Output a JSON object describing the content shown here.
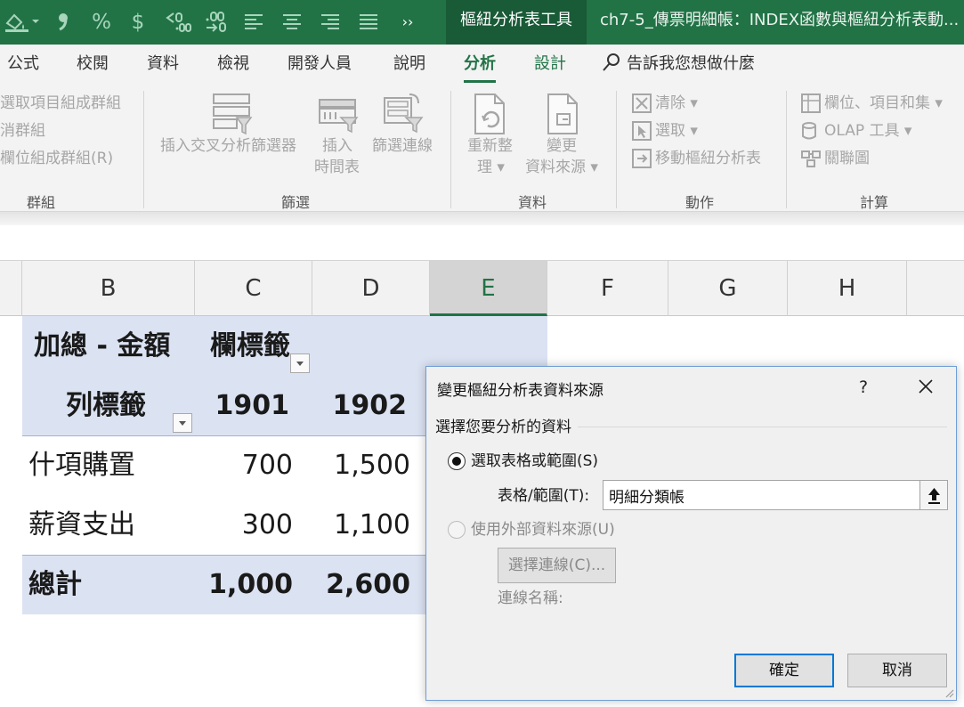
{
  "quick_access": {
    "icons": [
      "fill-color-icon",
      "comma-icon",
      "percent-icon",
      "currency-icon",
      "increase-decimal-icon",
      "decrease-decimal-icon",
      "align-left-icon",
      "align-center-icon",
      "align-right-icon",
      "justify-icon",
      "more-icon"
    ],
    "percent_glyph": "%",
    "currency_glyph": "$",
    "more_glyph": "››"
  },
  "titlebar": {
    "context_tab": "樞紐分析表工具",
    "document_title": "ch7-5_傳票明細帳：INDEX函數與樞紐分析表動..."
  },
  "tabs": [
    {
      "label": "公式"
    },
    {
      "label": "校閱"
    },
    {
      "label": "資料"
    },
    {
      "label": "檢視"
    },
    {
      "label": "開發人員"
    },
    {
      "label": "說明"
    },
    {
      "label": "分析",
      "active": true
    },
    {
      "label": "設計"
    }
  ],
  "tell_me": "告訴我您想做什麼",
  "ribbon": {
    "group_group": {
      "items": [
        "選取項目組成群組",
        "消群組",
        "欄位組成群組(R)"
      ],
      "name": "群組"
    },
    "group_filter": {
      "slicer": "插入交叉分析篩選器",
      "timeline_line1": "插入",
      "timeline_line2": "時間表",
      "connections": "篩選連線",
      "name": "篩選"
    },
    "group_data": {
      "refresh_line1": "重新整",
      "refresh_line2": "理 ▾",
      "change_line1": "變更",
      "change_line2": "資料來源 ▾",
      "name": "資料"
    },
    "group_actions": {
      "clear": "清除 ▾",
      "select": "選取 ▾",
      "move": "移動樞紐分析表",
      "name": "動作"
    },
    "group_calc": {
      "fields": "欄位、項目和集 ▾",
      "olap": "OLAP 工具 ▾",
      "relations": "關聯圖",
      "name": "計算"
    }
  },
  "columns": [
    "B",
    "C",
    "D",
    "E",
    "F",
    "G",
    "H"
  ],
  "selected_column": "E",
  "pivot": {
    "values_label": "加總 - 金額",
    "col_labels": "欄標籤",
    "row_labels": "列標籤",
    "headers": [
      "1901",
      "1902"
    ],
    "rows": [
      {
        "label": "什項購置",
        "values": [
          "700",
          "1,500"
        ]
      },
      {
        "label": "薪資支出",
        "values": [
          "300",
          "1,100"
        ]
      }
    ],
    "total": {
      "label": "總計",
      "values": [
        "1,000",
        "2,600"
      ]
    },
    "colors": {
      "band": "#dbe2f2",
      "line": "#9fb2d9"
    }
  },
  "dialog": {
    "title": "變更樞紐分析表資料來源",
    "help": "?",
    "section": "選擇您要分析的資料",
    "option_range": "選取表格或範圍(S)",
    "range_label": "表格/範圍(T):",
    "range_value": "明細分類帳",
    "option_external": "使用外部資料來源(U)",
    "choose_connection": "選擇連線(C)...",
    "connection_name": "連線名稱:",
    "ok": "確定",
    "cancel": "取消"
  },
  "theme": {
    "accent": "#217346",
    "dialog_border": "#6f9ed6",
    "default_button": "#0078d7"
  }
}
